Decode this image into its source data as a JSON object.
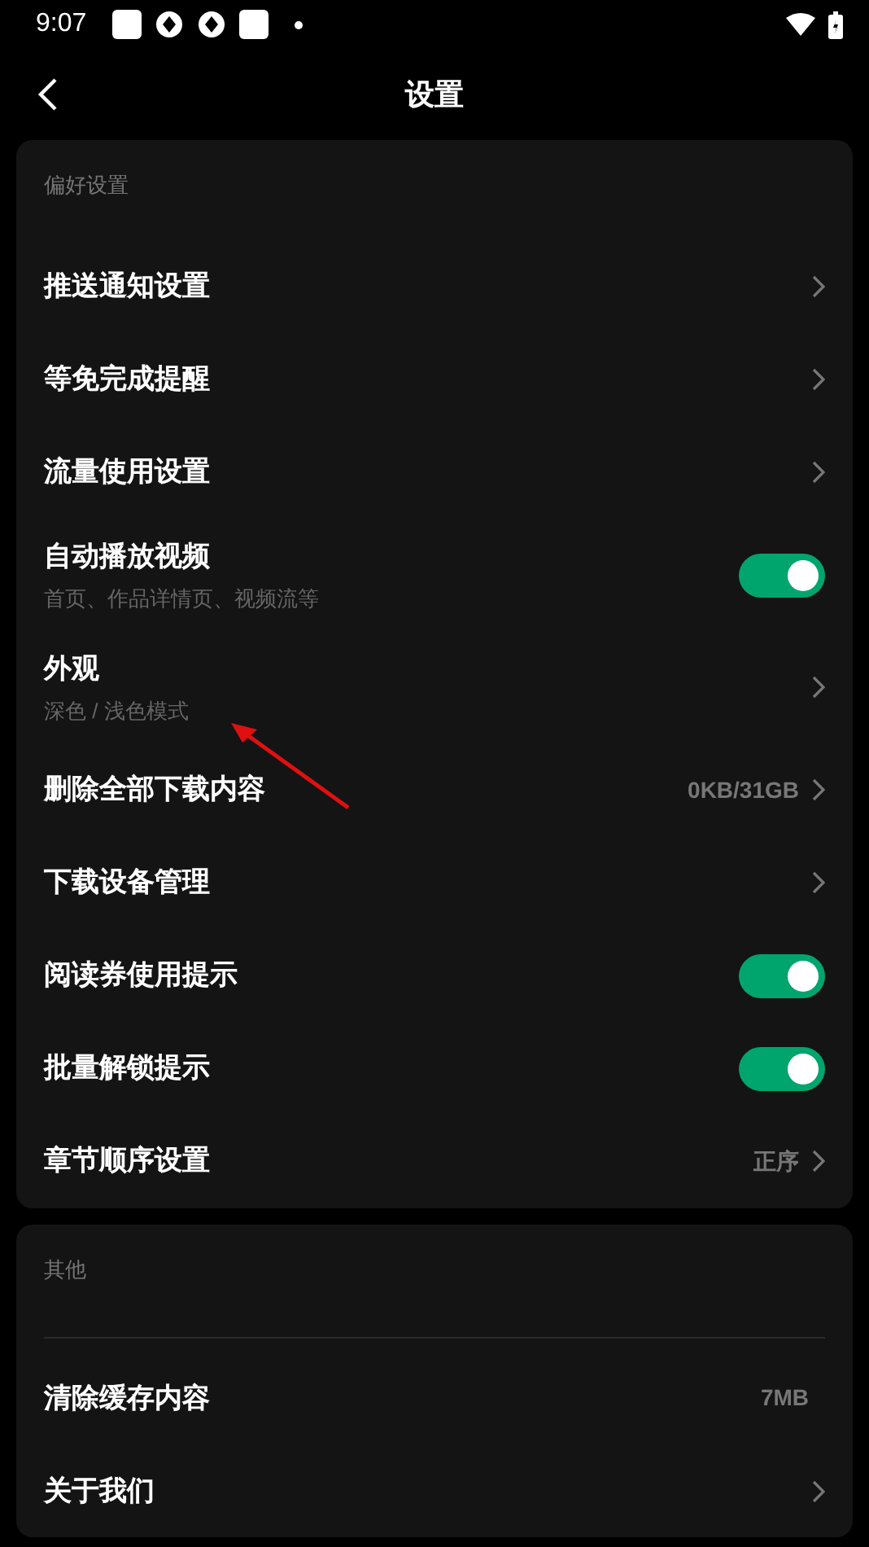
{
  "status_bar": {
    "time": "9:07"
  },
  "header": {
    "title": "设置"
  },
  "sections": [
    {
      "title": "偏好设置",
      "divider": false,
      "items": [
        {
          "kind": "link",
          "label": "推送通知设置"
        },
        {
          "kind": "link",
          "label": "等免完成提醒"
        },
        {
          "kind": "link",
          "label": "流量使用设置"
        },
        {
          "kind": "toggle",
          "label": "自动播放视频",
          "subtitle": "首页、作品详情页、视频流等",
          "on": true
        },
        {
          "kind": "link",
          "label": "外观",
          "subtitle": "深色 / 浅色模式"
        },
        {
          "kind": "link",
          "label": "删除全部下载内容",
          "value": "0KB/31GB"
        },
        {
          "kind": "link",
          "label": "下载设备管理"
        },
        {
          "kind": "toggle",
          "label": "阅读券使用提示",
          "on": true
        },
        {
          "kind": "toggle",
          "label": "批量解锁提示",
          "on": true
        },
        {
          "kind": "link",
          "label": "章节顺序设置",
          "value": "正序"
        }
      ]
    },
    {
      "title": "其他",
      "divider": true,
      "items": [
        {
          "kind": "info",
          "label": "清除缓存内容",
          "value": "7MB"
        },
        {
          "kind": "link",
          "label": "关于我们"
        }
      ]
    }
  ]
}
